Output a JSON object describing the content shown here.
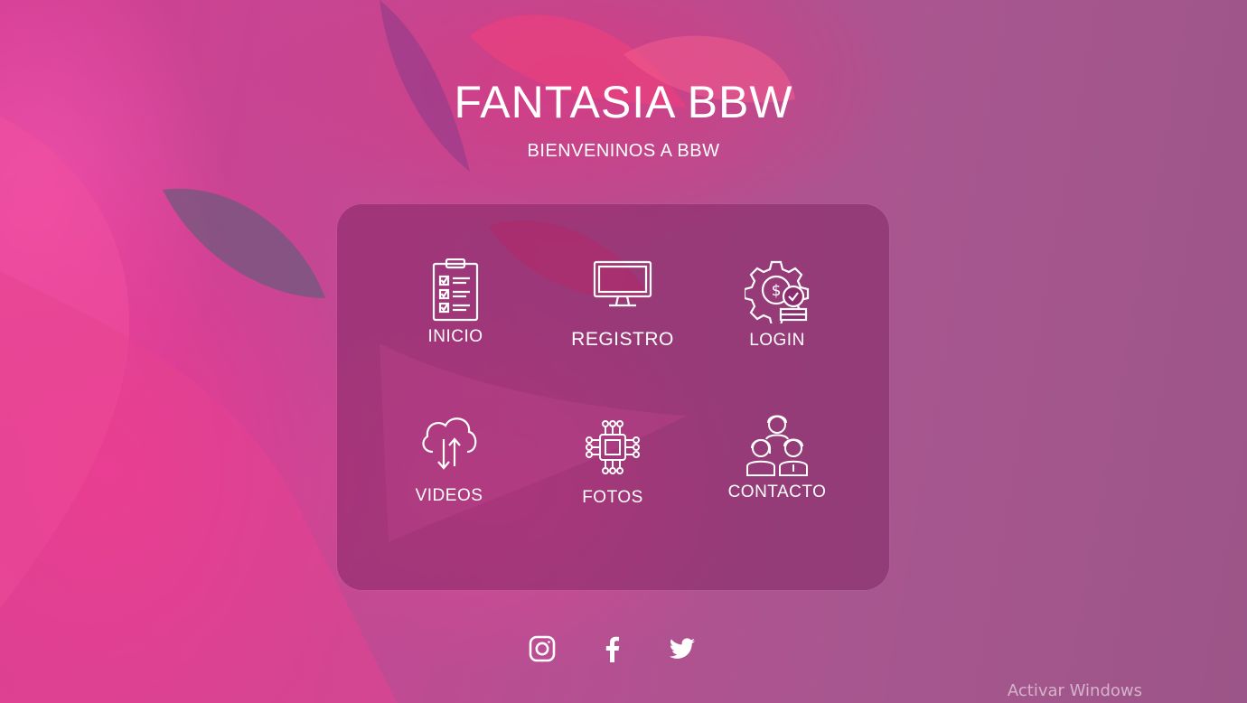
{
  "site": {
    "title": "FANTASIA BBW",
    "subtitle": "BIENVENINOS A BBW"
  },
  "menu": {
    "items": [
      {
        "label": "INICIO",
        "icon": "clipboard-checklist-icon"
      },
      {
        "label": "REGISTRO",
        "icon": "monitor-icon"
      },
      {
        "label": "LOGIN",
        "icon": "gear-dollar-check-icon"
      },
      {
        "label": "VIDEOS",
        "icon": "cloud-transfer-icon"
      },
      {
        "label": "FOTOS",
        "icon": "chip-icon"
      },
      {
        "label": "CONTACTO",
        "icon": "people-group-icon"
      }
    ]
  },
  "social": {
    "items": [
      {
        "name": "instagram-icon"
      },
      {
        "name": "facebook-icon"
      },
      {
        "name": "twitter-icon"
      }
    ]
  },
  "watermark": {
    "text": "Activar Windows"
  },
  "colors": {
    "background": "#a8568f",
    "accent": "#d23e92",
    "panel": "#781e5a"
  }
}
